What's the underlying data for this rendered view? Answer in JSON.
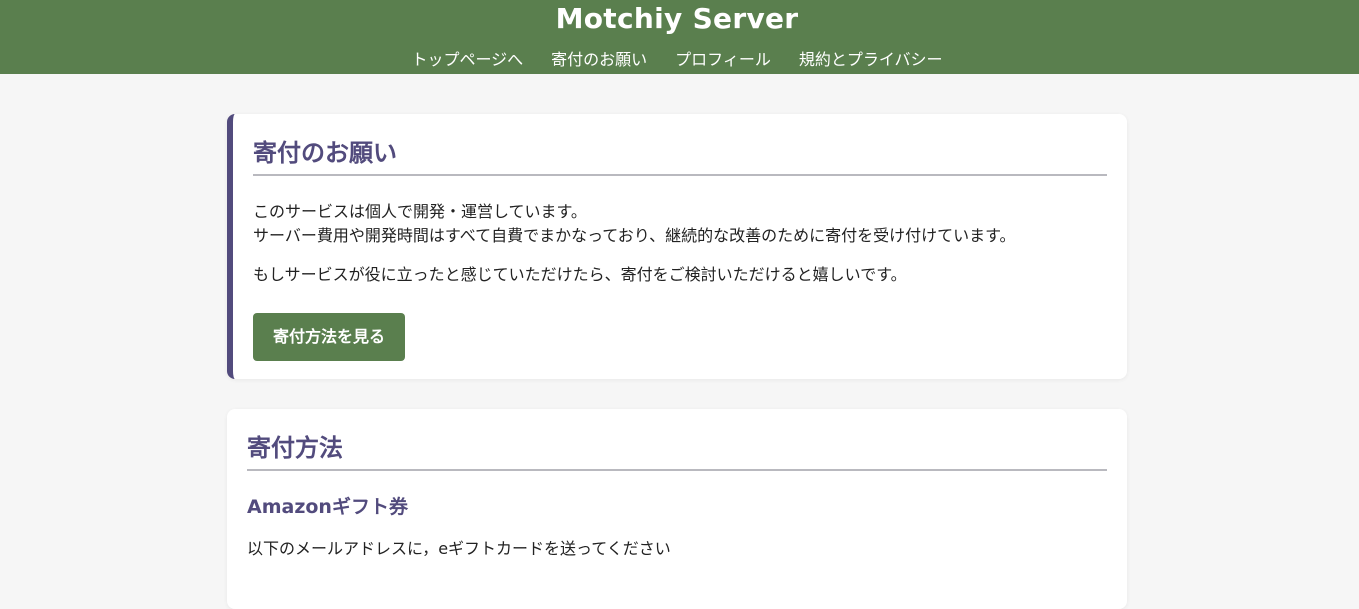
{
  "header": {
    "title": "Motchiy Server",
    "nav": [
      {
        "label": "トップページへ"
      },
      {
        "label": "寄付のお願い"
      },
      {
        "label": "プロフィール"
      },
      {
        "label": "規約とプライバシー"
      }
    ]
  },
  "request": {
    "heading": "寄付のお願い",
    "line1": "このサービスは個人で開発・運営しています。",
    "line2": "サーバー費用や開発時間はすべて自費でまかなっており、継続的な改善のために寄付を受け付けています。",
    "line3": "もしサービスが役に立ったと感じていただけたら、寄付をご検討いただけると嬉しいです。",
    "button_label": "寄付方法を見る"
  },
  "methods": {
    "heading": "寄付方法",
    "amazon_heading": "Amazonギフト券",
    "amazon_desc": "以下のメールアドレスに，eギフトカードを送ってください"
  },
  "colors": {
    "header_bg": "#5a7f4e",
    "accent_purple": "#524b7d",
    "page_bg": "#f6f6f6"
  }
}
